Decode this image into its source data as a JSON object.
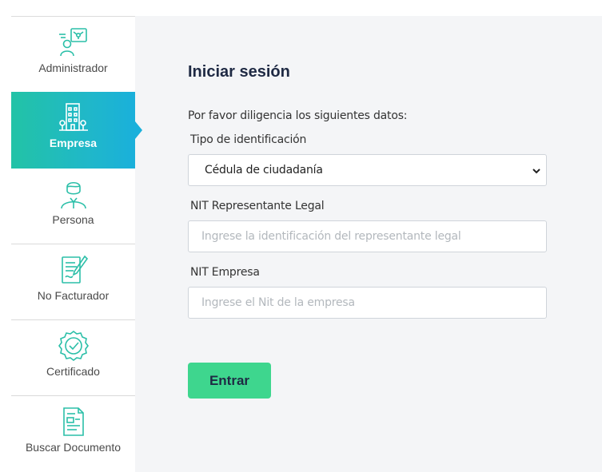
{
  "sidebar": {
    "items": [
      {
        "label": "Administrador",
        "icon": "admin-network-icon",
        "active": false
      },
      {
        "label": "Empresa",
        "icon": "building-icon",
        "active": true
      },
      {
        "label": "Persona",
        "icon": "person-icon",
        "active": false
      },
      {
        "label": "No Facturador",
        "icon": "document-pen-icon",
        "active": false
      },
      {
        "label": "Certificado",
        "icon": "certificate-badge-icon",
        "active": false
      },
      {
        "label": "Buscar Documento",
        "icon": "search-document-icon",
        "active": false
      }
    ]
  },
  "login": {
    "title": "Iniciar sesión",
    "instructions": "Por favor diligencia los siguientes datos:",
    "id_type_label": "Tipo de identificación",
    "id_type_value": "Cédula de ciudadanía",
    "rep_label": "NIT Representante Legal",
    "rep_placeholder": "Ingrese la identificación del representante legal",
    "company_label": "NIT Empresa",
    "company_placeholder": "Ingrese el Nit de la empresa",
    "submit_label": "Entrar"
  },
  "colors": {
    "accent_gradient_start": "#22c3a6",
    "accent_gradient_end": "#1ab0db",
    "icon_teal": "#2bbfa8",
    "button_green": "#3ed68e",
    "title_navy": "#1f2a44"
  }
}
